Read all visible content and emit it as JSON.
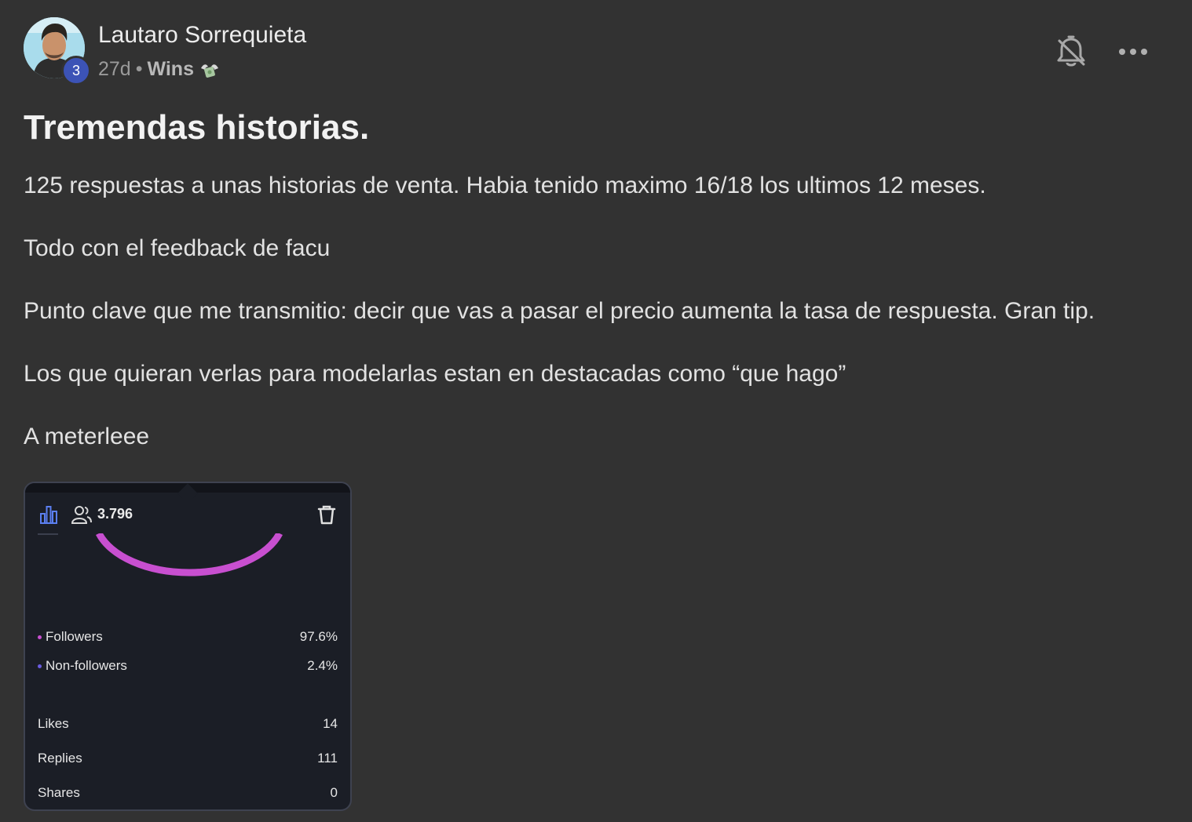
{
  "post": {
    "author": "Lautaro Sorrequieta",
    "level": "3",
    "age": "27d",
    "separator": "•",
    "category": "Wins",
    "category_icon": "money-wings-icon",
    "title": "Tremendas historias.",
    "paragraphs": [
      "125 respuestas a unas historias de venta. Habia tenido maximo 16/18 los ultimos 12 meses.",
      "Todo con el feedback de facu",
      "Punto clave que me transmitio: decir que vas a pasar el precio aumenta la tasa de respuesta. Gran tip.",
      "Los que quieran verlas para modelarlas estan en destacadas como “que hago”",
      "A meterleee"
    ]
  },
  "actions": {
    "bell_icon": "bell-muted-icon",
    "more_icon": "more-horizontal-icon"
  },
  "insight_card": {
    "viewers": "3.796",
    "audience": [
      {
        "label": "Followers",
        "value": "97.6%",
        "color": "#c84fd0"
      },
      {
        "label": "Non-followers",
        "value": "2.4%",
        "color": "#6a5ce0"
      }
    ],
    "metrics": [
      {
        "label": "Likes",
        "value": "14"
      },
      {
        "label": "Replies",
        "value": "111"
      },
      {
        "label": "Shares",
        "value": "0"
      }
    ],
    "gauge_color": "#c84fd0"
  },
  "colors": {
    "background": "#323232",
    "badge": "#3c53b6",
    "accent_icon": "#5b7ff0"
  }
}
